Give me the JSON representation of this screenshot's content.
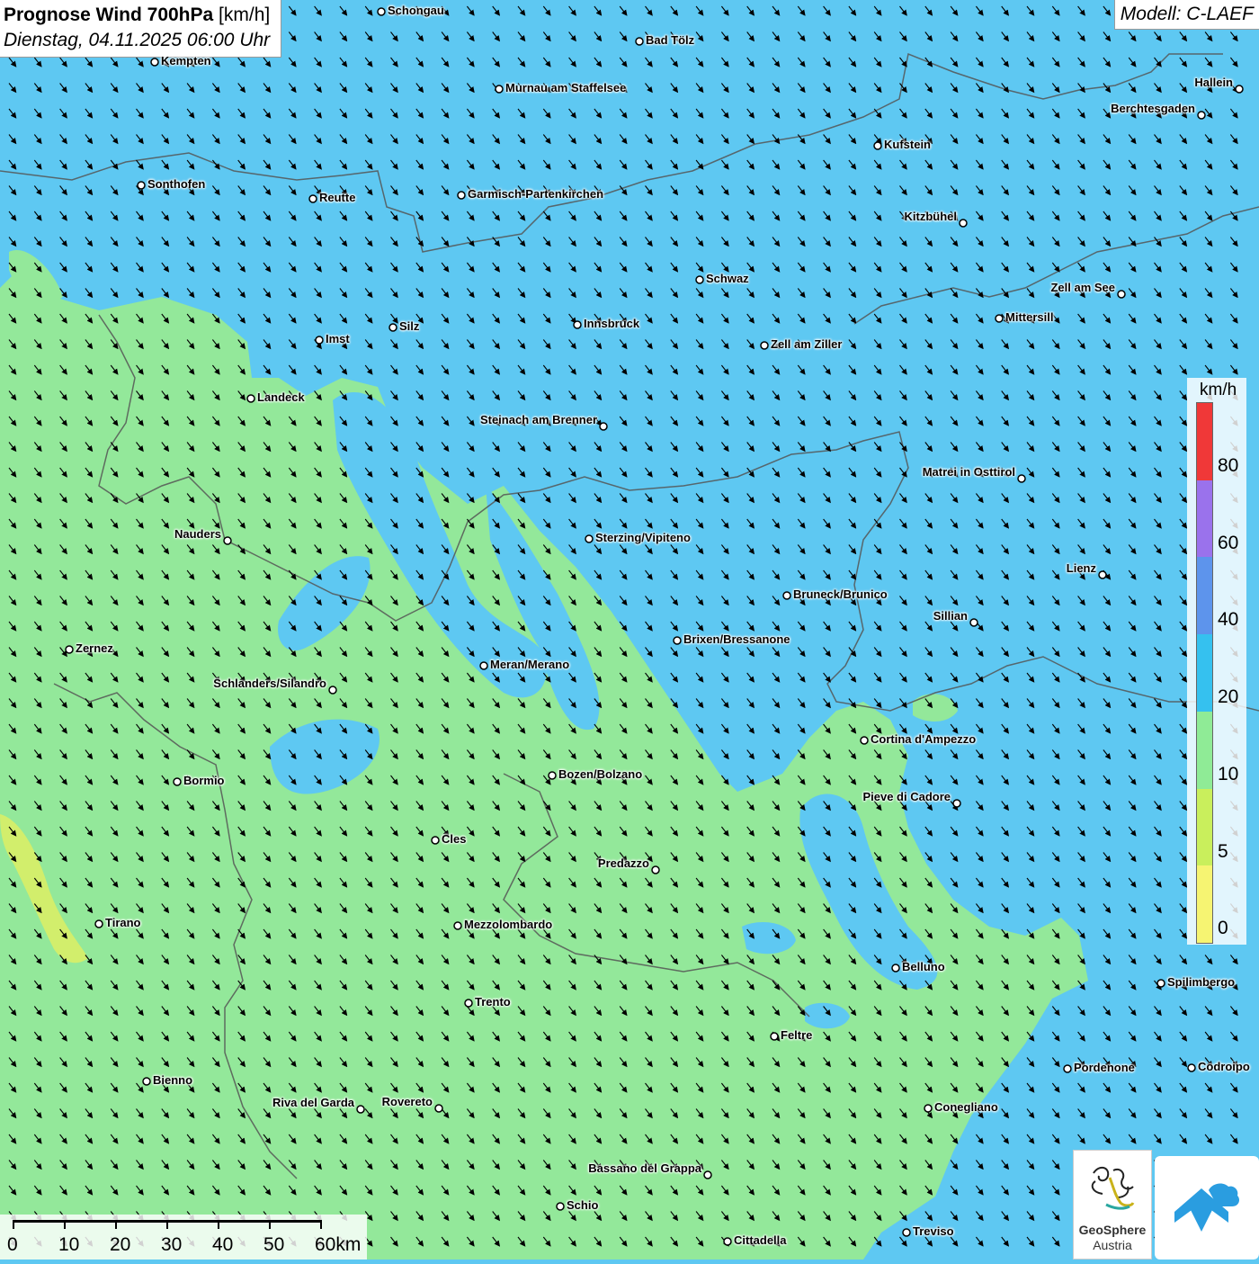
{
  "title": {
    "main": "Prognose Wind 700hPa",
    "unit": "[km/h]",
    "date": "Dienstag, 04.11.2025 06:00 Uhr"
  },
  "model": "Modell: C-LAEF",
  "legend": {
    "unit": "km/h",
    "labels": [
      "80",
      "60",
      "40",
      "20",
      "10",
      "5",
      "0"
    ],
    "colors": [
      "#f03838",
      "#9a72ec",
      "#5d94ec",
      "#35c1ef",
      "#8feb96",
      "#c9ef5c",
      "#f6f472"
    ]
  },
  "scalebar": {
    "labels": [
      "0",
      "10",
      "20",
      "30",
      "40",
      "50",
      "60km"
    ]
  },
  "logos": {
    "geosphere_line1": "GeoSphere",
    "geosphere_line2": "Austria"
  },
  "wind": {
    "direction": "north-west",
    "typical_speed_kmh": "10-20"
  },
  "cities": [
    {
      "name": "Schongau"
    },
    {
      "name": "Bad Tölz"
    },
    {
      "name": "Kempten"
    },
    {
      "name": "Murnau am Staffelsee"
    },
    {
      "name": "Hallein"
    },
    {
      "name": "Berchtesgaden"
    },
    {
      "name": "Kufstein"
    },
    {
      "name": "Sonthofen"
    },
    {
      "name": "Reutte"
    },
    {
      "name": "Garmisch-Partenkirchen"
    },
    {
      "name": "Kitzbühel"
    },
    {
      "name": "Schwaz"
    },
    {
      "name": "Zell am See"
    },
    {
      "name": "Mittersill"
    },
    {
      "name": "Innsbruck"
    },
    {
      "name": "Silz"
    },
    {
      "name": "Imst"
    },
    {
      "name": "Zell am Ziller"
    },
    {
      "name": "Landeck"
    },
    {
      "name": "Steinach am Brenner"
    },
    {
      "name": "Matrei in Osttirol"
    },
    {
      "name": "Nauders"
    },
    {
      "name": "Sterzing/Vipiteno"
    },
    {
      "name": "Lienz"
    },
    {
      "name": "Bruneck/Brunico"
    },
    {
      "name": "Sillian"
    },
    {
      "name": "Brixen/Bressanone"
    },
    {
      "name": "Zernez"
    },
    {
      "name": "Meran/Merano"
    },
    {
      "name": "Schlanders/Silandro"
    },
    {
      "name": "Cortina d'Ampezzo"
    },
    {
      "name": "Bozen/Bolzano"
    },
    {
      "name": "Bormio"
    },
    {
      "name": "Pieve di Cadore"
    },
    {
      "name": "Cles"
    },
    {
      "name": "Predazzo"
    },
    {
      "name": "Tirano"
    },
    {
      "name": "Mezzolombardo"
    },
    {
      "name": "Belluno"
    },
    {
      "name": "Spilimbergo"
    },
    {
      "name": "Trento"
    },
    {
      "name": "Feltre"
    },
    {
      "name": "Pordenone"
    },
    {
      "name": "Codroipo"
    },
    {
      "name": "Bienno"
    },
    {
      "name": "Riva del Garda"
    },
    {
      "name": "Rovereto"
    },
    {
      "name": "Conegliano"
    },
    {
      "name": "Bassano del Grappa"
    },
    {
      "name": "Schio"
    },
    {
      "name": "Treviso"
    },
    {
      "name": "Cittadella"
    }
  ]
}
